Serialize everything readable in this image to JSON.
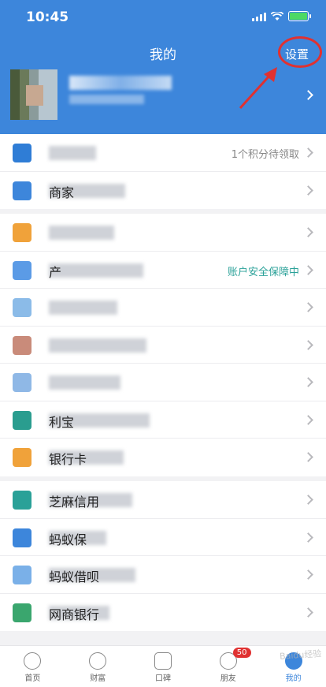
{
  "status": {
    "time": "10:45"
  },
  "header": {
    "title": "我的",
    "settings_label": "设置"
  },
  "lists": [
    [
      {
        "id": "points",
        "label": "",
        "right": "1个积分待领取",
        "right_color": "#888888",
        "icon_color": "#2f7dd6"
      },
      {
        "id": "merchant",
        "label": "商家",
        "right": "",
        "icon_color": "#3d86db"
      }
    ],
    [
      {
        "id": "bill",
        "label": "",
        "right": "",
        "icon_color": "#f0a23a"
      },
      {
        "id": "assets",
        "label": "产",
        "right": "账户安全保障中",
        "right_color": "#2aa198",
        "icon_color": "#5b9be6"
      },
      {
        "id": "item3",
        "label": "",
        "right": "",
        "icon_color": "#8bbbe8"
      },
      {
        "id": "item4",
        "label": "",
        "right": "",
        "icon_color": "#c98b7a"
      },
      {
        "id": "item5",
        "label": "",
        "right": "",
        "icon_color": "#8fb8e6"
      },
      {
        "id": "yuebao",
        "label": "利宝",
        "right": "",
        "icon_color": "#2a9d8f"
      },
      {
        "id": "bankcard",
        "label": "银行卡",
        "right": "",
        "icon_color": "#f0a23a"
      }
    ],
    [
      {
        "id": "credit",
        "label": "芝麻信用",
        "right": "",
        "icon_color": "#2aa198"
      },
      {
        "id": "insurance",
        "label": "蚂蚁保",
        "right": "",
        "icon_color": "#3d86db"
      },
      {
        "id": "loan",
        "label": "蚂蚁借呗",
        "right": "",
        "icon_color": "#7ab0e8"
      },
      {
        "id": "bank",
        "label": "网商银行",
        "right": "",
        "icon_color": "#3aa66e"
      }
    ]
  ],
  "tabbar": [
    {
      "id": "home",
      "label": "首页",
      "icon": "home-icon"
    },
    {
      "id": "wealth",
      "label": "财富",
      "icon": "yen-icon"
    },
    {
      "id": "koubei",
      "label": "口碑",
      "icon": "koubei-icon"
    },
    {
      "id": "friends",
      "label": "朋友",
      "icon": "friends-icon",
      "badge": "50"
    },
    {
      "id": "mine",
      "label": "我的",
      "icon": "person-icon",
      "active": true
    }
  ],
  "watermark": "Baidu经验"
}
